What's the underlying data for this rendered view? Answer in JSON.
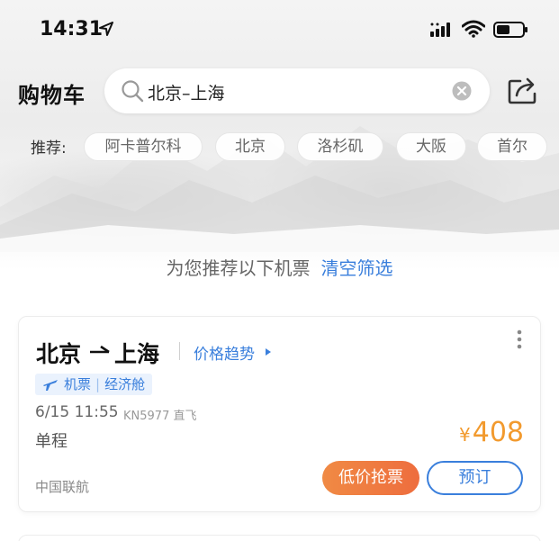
{
  "status_bar": {
    "time": "14:31"
  },
  "header": {
    "title": "购物车",
    "search_value": "北京–上海"
  },
  "recommend": {
    "label": "推荐:",
    "tags": [
      "阿卡普尔科",
      "北京",
      "洛杉矶",
      "大阪",
      "首尔"
    ]
  },
  "filter_line": {
    "text": "为您推荐以下机票",
    "clear_label": "清空筛选"
  },
  "card": {
    "from": "北京",
    "to": "上海",
    "trend_label": "价格趋势",
    "badge_type": "机票",
    "badge_class": "经济舱",
    "datetime": "6/15 11:55",
    "flight_info": "KN5977 直飞",
    "trip_type": "单程",
    "currency": "¥",
    "price": "408",
    "airline": "中国联航",
    "lowprice_label": "低价抢票",
    "book_label": "预订"
  },
  "colors": {
    "accent_blue": "#3a7fdc",
    "price_orange": "#f29a2e",
    "button_orange": "#ee6d3e"
  },
  "icons": [
    "location-arrow-icon",
    "signal-icon",
    "wifi-icon",
    "battery-icon",
    "search-icon",
    "clear-icon",
    "share-icon",
    "arrow-right-icon",
    "triangle-right-icon",
    "more-icon",
    "plane-icon"
  ]
}
